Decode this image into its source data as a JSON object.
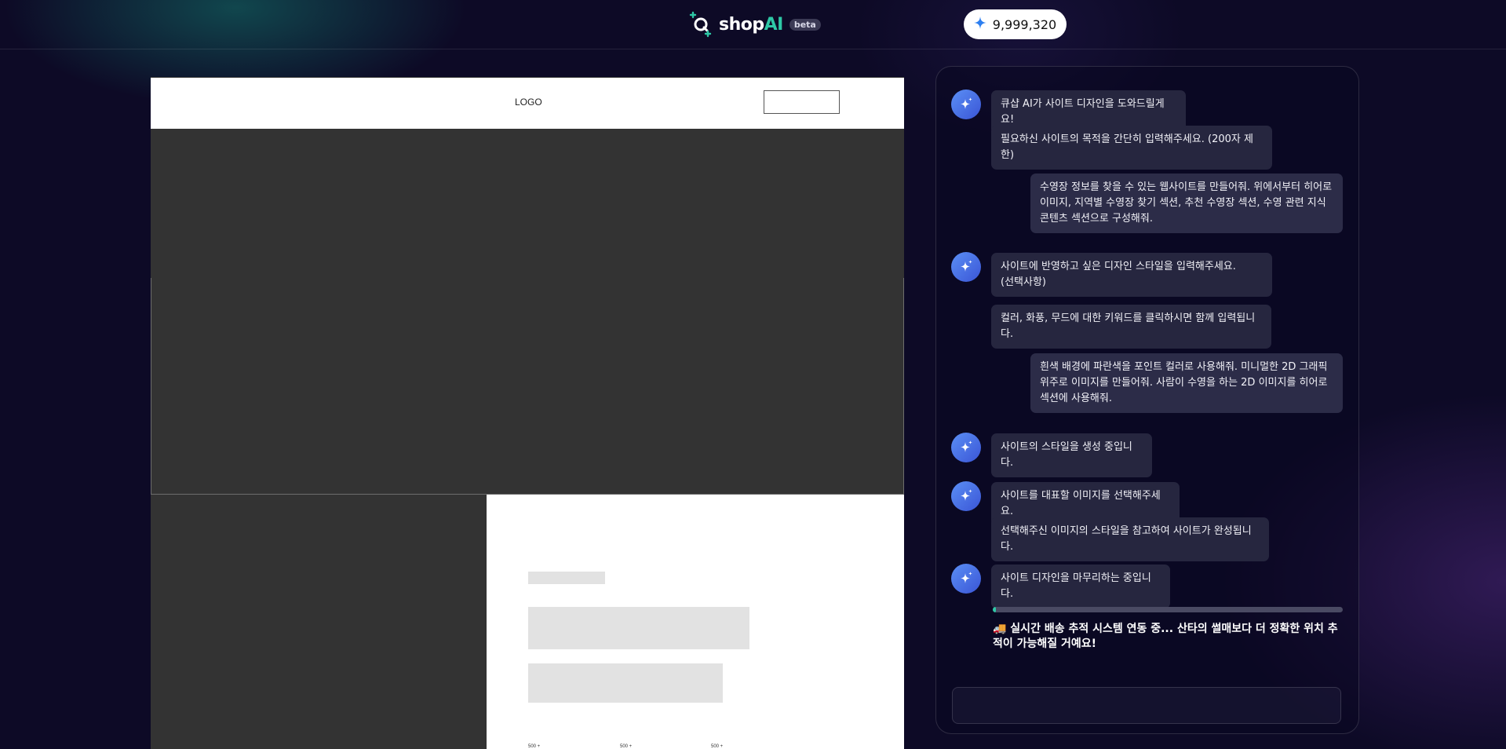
{
  "header": {
    "brand_text": "shop",
    "brand_ai": "AI",
    "beta_label": "beta",
    "credits": "9,999,320"
  },
  "preview": {
    "logo_text": "LOGO",
    "small_labels": [
      "500 +",
      "500 +",
      "500 +"
    ]
  },
  "chat": {
    "messages": [
      {
        "role": "ai",
        "text": "큐샵 AI가 사이트 디자인을 도와드릴게요!"
      },
      {
        "role": "ai",
        "text": "필요하신 사이트의 목적을 간단히 입력해주세요. (200자 제한)"
      },
      {
        "role": "user",
        "text": "수영장 정보를 찾을 수 있는 웹사이트를 만들어줘. 위에서부터 히어로\n이미지, 지역별 수영장 찾기 섹션, 추천 수영장 섹션, 수영 관련 지식\n콘텐츠 섹션으로 구성해줘."
      },
      {
        "role": "ai",
        "text": "사이트에 반영하고 싶은 디자인 스타일을 입력해주세요.\n(선택사항)"
      },
      {
        "role": "ai",
        "text": "컬러, 화풍, 무드에 대한 키워드를 클릭하시면 함께 입력됩니다."
      },
      {
        "role": "user",
        "text": "흰색 배경에 파란색을 포인트 컬러로 사용해줘. 미니멀한 2D 그래픽\n위주로 이미지를 만들어줘. 사람이 수영을 하는 2D 이미지를 히어로\n섹션에 사용해줘."
      },
      {
        "role": "ai",
        "text": "사이트의 스타일을 생성 중입니다."
      },
      {
        "role": "ai",
        "text": "사이트를 대표할 이미지를 선택해주세요."
      },
      {
        "role": "ai",
        "text": "선택해주신 이미지의 스타일을 참고하여 사이트가 완성됩니다."
      },
      {
        "role": "ai",
        "text": "사이트 디자인을 마무리하는 중입니다."
      }
    ],
    "progress": 0.01,
    "loading_text": "🚚 실시간 배송 추적 시스템 연동 중... 산타의 썰매보다 더 정확한 위치 추적이 가능해질 거예요!",
    "input_value": ""
  },
  "colors": {
    "accent": "#2ec8a6",
    "avatar": "#4a72e8",
    "background": "#0d0a26",
    "bubble": "#26263f"
  },
  "icons": {
    "brand": "shop-logo-icon",
    "credits": "sparkle-icon",
    "avatar": "sparkles-icon"
  }
}
